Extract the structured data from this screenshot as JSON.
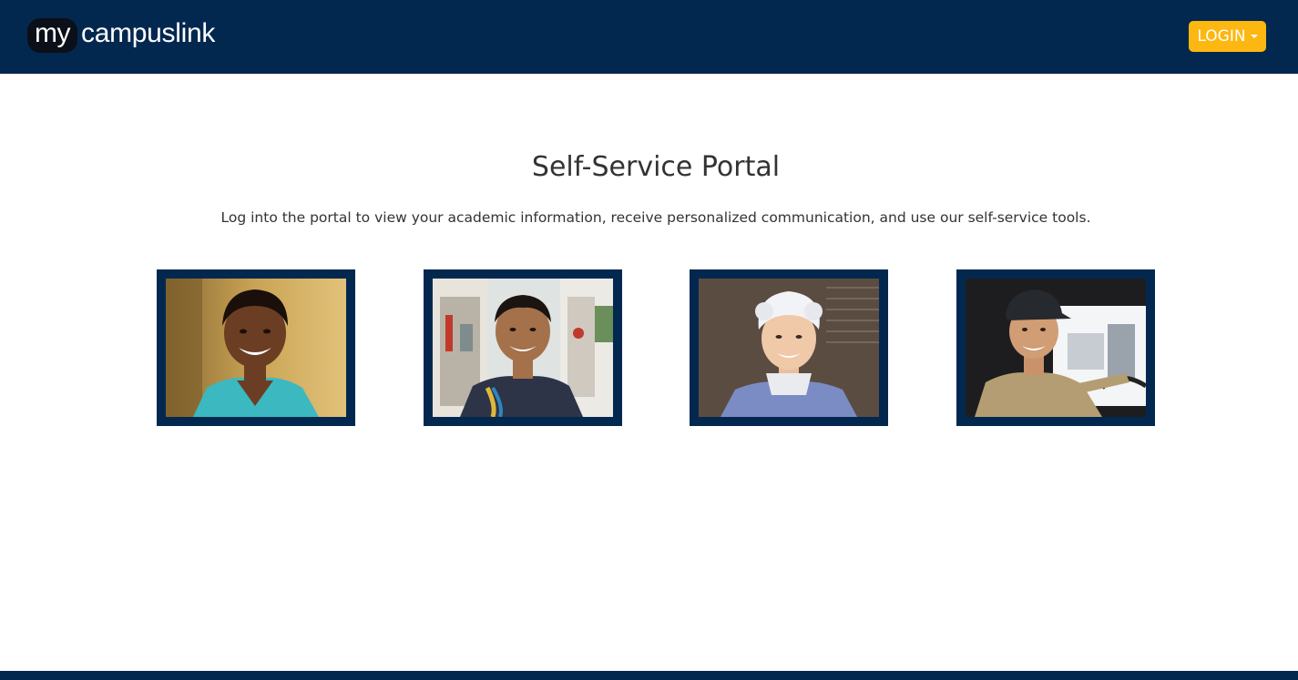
{
  "header": {
    "logo_prefix": "my",
    "logo_text": "campuslink",
    "login_label": "LOGIN"
  },
  "main": {
    "title": "Self-Service Portal",
    "intro": "Log into the portal to view your academic information, receive personalized communication, and use our self-service tools."
  },
  "colors": {
    "navy": "#03284f",
    "accent": "#fcb711"
  }
}
